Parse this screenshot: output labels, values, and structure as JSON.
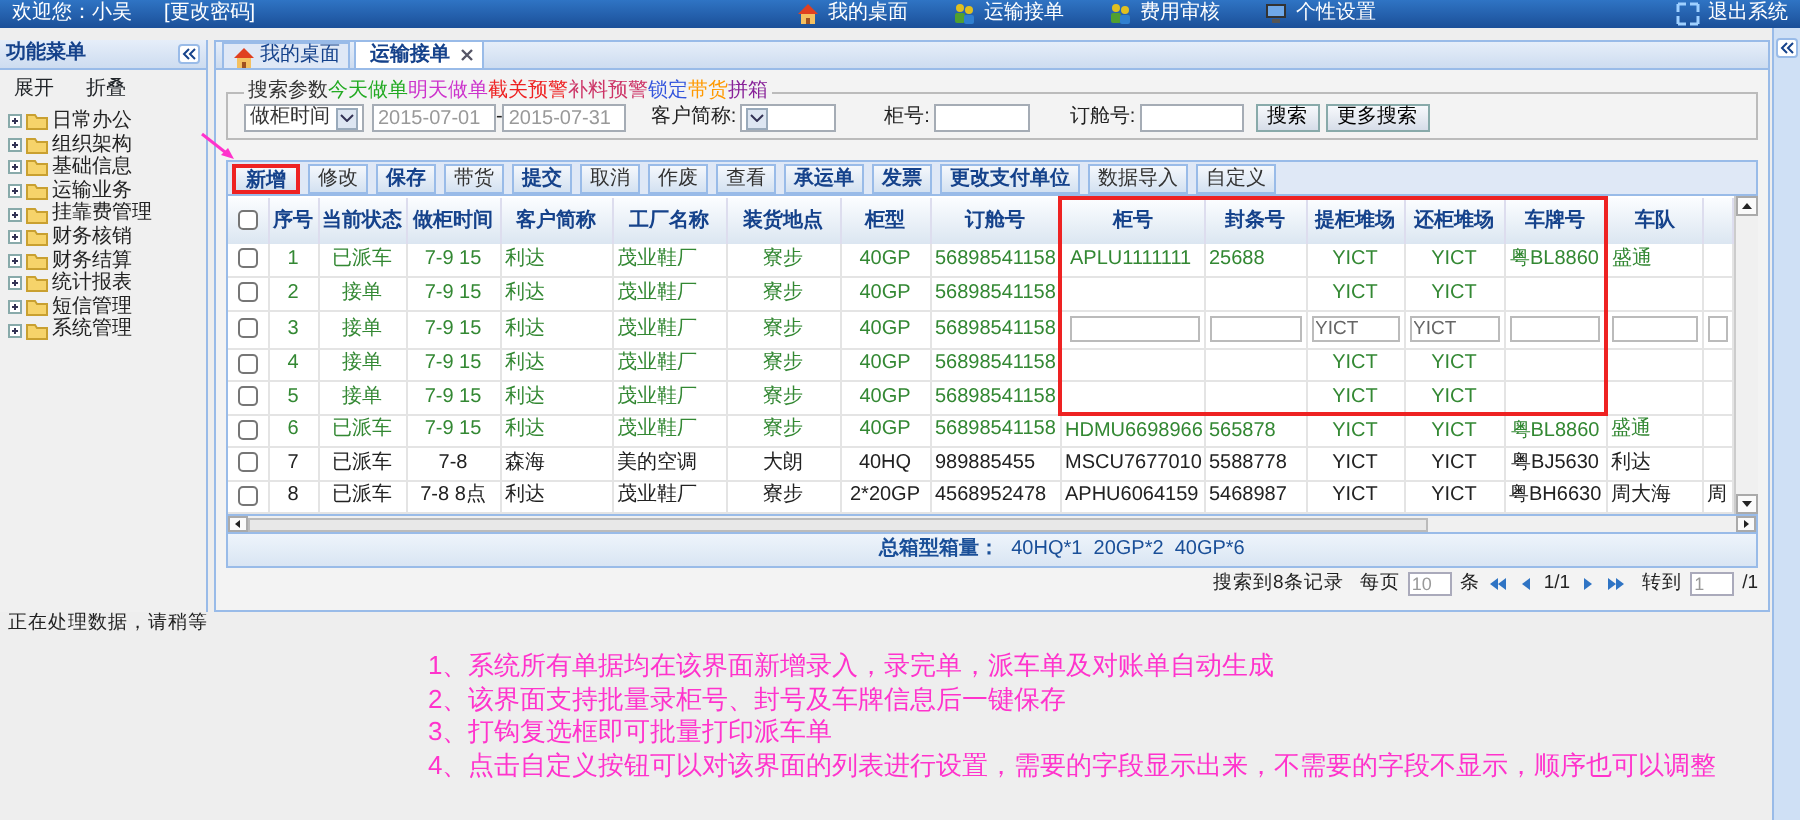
{
  "top_bar": {
    "welcome": "欢迎您：小吴",
    "change_password": "[更改密码]",
    "links": [
      {
        "kind": "home",
        "label": "我的桌面"
      },
      {
        "kind": "people",
        "label": "运输接单"
      },
      {
        "kind": "people",
        "label": "费用审核"
      },
      {
        "kind": "monitor",
        "label": "个性设置"
      }
    ],
    "logout": "退出系统"
  },
  "sidebar": {
    "title": "功能菜单",
    "actions": [
      "展开",
      "折叠"
    ],
    "items": [
      {
        "label": "日常办公"
      },
      {
        "label": "组织架构"
      },
      {
        "label": "基础信息"
      },
      {
        "label": "运输业务"
      },
      {
        "label": "挂靠费管理"
      },
      {
        "label": "财务核销"
      },
      {
        "label": "财务结算"
      },
      {
        "label": "统计报表"
      },
      {
        "label": "短信管理"
      },
      {
        "label": "系统管理"
      }
    ]
  },
  "tabs": [
    {
      "label": "我的桌面",
      "selected": false,
      "closable": false
    },
    {
      "label": "运输接单",
      "selected": true,
      "closable": true
    }
  ],
  "search": {
    "legend": [
      {
        "text": "搜索参数",
        "color": "#333333"
      },
      {
        "text": "今天做单",
        "color": "#22aa22"
      },
      {
        "text": "明天做单",
        "color": "#cc33cc"
      },
      {
        "text": "截关预警",
        "color": "#ee2222"
      },
      {
        "text": "补料预警",
        "color": "#cc3366"
      },
      {
        "text": "锁定",
        "color": "#3355dd"
      },
      {
        "text": "带货",
        "color": "#ff9900"
      },
      {
        "text": "拼箱",
        "color": "#882299"
      }
    ],
    "date_field": "做柜时间",
    "date_from": "2015-07-01",
    "date_sep": "-",
    "date_to": "2015-07-31",
    "customer_label": "客户简称:",
    "container_label": "柜号:",
    "booking_label": "订舱号:",
    "buttons": [
      "搜索",
      "更多搜索"
    ]
  },
  "toolbar": [
    {
      "label": "新增",
      "emphasis": true,
      "highlighted": true
    },
    {
      "label": "修改",
      "emphasis": false,
      "highlighted": false
    },
    {
      "label": "保存",
      "emphasis": true,
      "highlighted": false
    },
    {
      "label": "带货",
      "emphasis": false,
      "highlighted": false
    },
    {
      "label": "提交",
      "emphasis": true,
      "highlighted": false
    },
    {
      "label": "取消",
      "emphasis": false,
      "highlighted": false
    },
    {
      "label": "作废",
      "emphasis": false,
      "highlighted": false
    },
    {
      "label": "查看",
      "emphasis": false,
      "highlighted": false
    },
    {
      "label": "承运单",
      "emphasis": true,
      "highlighted": false
    },
    {
      "label": "发票",
      "emphasis": true,
      "highlighted": false
    },
    {
      "label": "更改支付单位",
      "emphasis": true,
      "highlighted": false
    },
    {
      "label": "数据导入",
      "emphasis": false,
      "highlighted": false
    },
    {
      "label": "自定义",
      "emphasis": false,
      "highlighted": false
    }
  ],
  "table": {
    "select_all_checked": false,
    "columns": [
      {
        "label": "序号",
        "highlighted": false,
        "editable": false
      },
      {
        "label": "当前状态",
        "highlighted": false,
        "editable": false
      },
      {
        "label": "做柜时间",
        "highlighted": false,
        "editable": false
      },
      {
        "label": "客户简称",
        "highlighted": false,
        "editable": false
      },
      {
        "label": "工厂名称",
        "highlighted": false,
        "editable": false
      },
      {
        "label": "装货地点",
        "highlighted": false,
        "editable": false
      },
      {
        "label": "柜型",
        "highlighted": false,
        "editable": false
      },
      {
        "label": "订舱号",
        "highlighted": false,
        "editable": false
      },
      {
        "label": "柜号",
        "highlighted": true,
        "editable": true
      },
      {
        "label": "封条号",
        "highlighted": true,
        "editable": true
      },
      {
        "label": "提柜堆场",
        "highlighted": true,
        "editable": true
      },
      {
        "label": "还柜堆场",
        "highlighted": true,
        "editable": true
      },
      {
        "label": "车牌号",
        "highlighted": true,
        "editable": true
      },
      {
        "label": "车队",
        "highlighted": false,
        "editable": true
      },
      {
        "highlighted": false,
        "editable": true
      }
    ],
    "rows": [
      {
        "kind": "view",
        "checked": false,
        "highlighted": true,
        "color": "#338833",
        "cells": [
          "1",
          "已派车",
          "7-9 15",
          "利达",
          "茂业鞋厂",
          "寮步",
          "40GP",
          "56898541158",
          "APLU1111111",
          "25688",
          "YICT",
          "YICT",
          "粤BL8860",
          "盛通",
          null
        ]
      },
      {
        "kind": "view",
        "checked": false,
        "highlighted": true,
        "color": "#338833",
        "cells": [
          "2",
          "接单",
          "7-9 15",
          "利达",
          "茂业鞋厂",
          "寮步",
          "40GP",
          "56898541158",
          null,
          null,
          "YICT",
          "YICT",
          null,
          null,
          null
        ]
      },
      {
        "kind": "edit",
        "checked": false,
        "highlighted": true,
        "color": "#338833",
        "cells": [
          "3",
          "接单",
          "7-9 15",
          "利达",
          "茂业鞋厂",
          "寮步",
          "40GP",
          "56898541158",
          null,
          null,
          "YICT",
          "YICT",
          null,
          null,
          null
        ]
      },
      {
        "kind": "view",
        "checked": false,
        "highlighted": true,
        "color": "#338833",
        "cells": [
          "4",
          "接单",
          "7-9 15",
          "利达",
          "茂业鞋厂",
          "寮步",
          "40GP",
          "56898541158",
          null,
          null,
          "YICT",
          "YICT",
          null,
          null,
          null
        ]
      },
      {
        "kind": "view",
        "checked": false,
        "highlighted": true,
        "color": "#338833",
        "cells": [
          "5",
          "接单",
          "7-9 15",
          "利达",
          "茂业鞋厂",
          "寮步",
          "40GP",
          "56898541158",
          null,
          null,
          "YICT",
          "YICT",
          null,
          null,
          null
        ]
      },
      {
        "kind": "view",
        "checked": false,
        "highlighted": false,
        "color": "#338833",
        "cells": [
          "6",
          "已派车",
          "7-9 15",
          "利达",
          "茂业鞋厂",
          "寮步",
          "40GP",
          "56898541158",
          "HDMU6698966",
          "565878",
          "YICT",
          "YICT",
          "粤BL8860",
          "盛通",
          null
        ]
      },
      {
        "kind": "view",
        "checked": false,
        "highlighted": false,
        "color": "#222222",
        "cells": [
          "7",
          "已派车",
          "7-8",
          "森海",
          "美的空调",
          "大朗",
          "40HQ",
          "989885455",
          "MSCU7677010",
          "5588778",
          "YICT",
          "YICT",
          "粤BJ5630",
          "利达",
          null
        ]
      },
      {
        "kind": "view",
        "checked": false,
        "highlighted": false,
        "color": "#222222",
        "cells": [
          "8",
          "已派车",
          "7-8 8点",
          "利达",
          "茂业鞋厂",
          "寮步",
          "2*20GP",
          "4568952478",
          "APHU6064159",
          "5468987",
          "YICT",
          "YICT",
          "粤BH6630",
          "周大海",
          "周"
        ]
      }
    ],
    "summary_label": "总箱型箱量：",
    "summary": "40HQ*1  20GP*2  40GP*6"
  },
  "pagination": {
    "found": "搜索到8条记录",
    "per_page_label": "每页",
    "per_page": "10",
    "unit": "条",
    "page": "1/1",
    "goto_label": "转到",
    "goto": "1",
    "total": "/1"
  },
  "status_text": "正在处理数据，请稍等",
  "notes": [
    "1、系统所有单据均在该界面新增录入，录完单，派车单及对账单自动生成",
    "2、该界面支持批量录柜号、封号及车牌信息后一键保存",
    "3、打钩复选框即可批量打印派车单",
    "4、点击自定义按钮可以对该界面的列表进行设置，需要的字段显示出来，不需要的字段不显示，顺序也可以调整"
  ]
}
